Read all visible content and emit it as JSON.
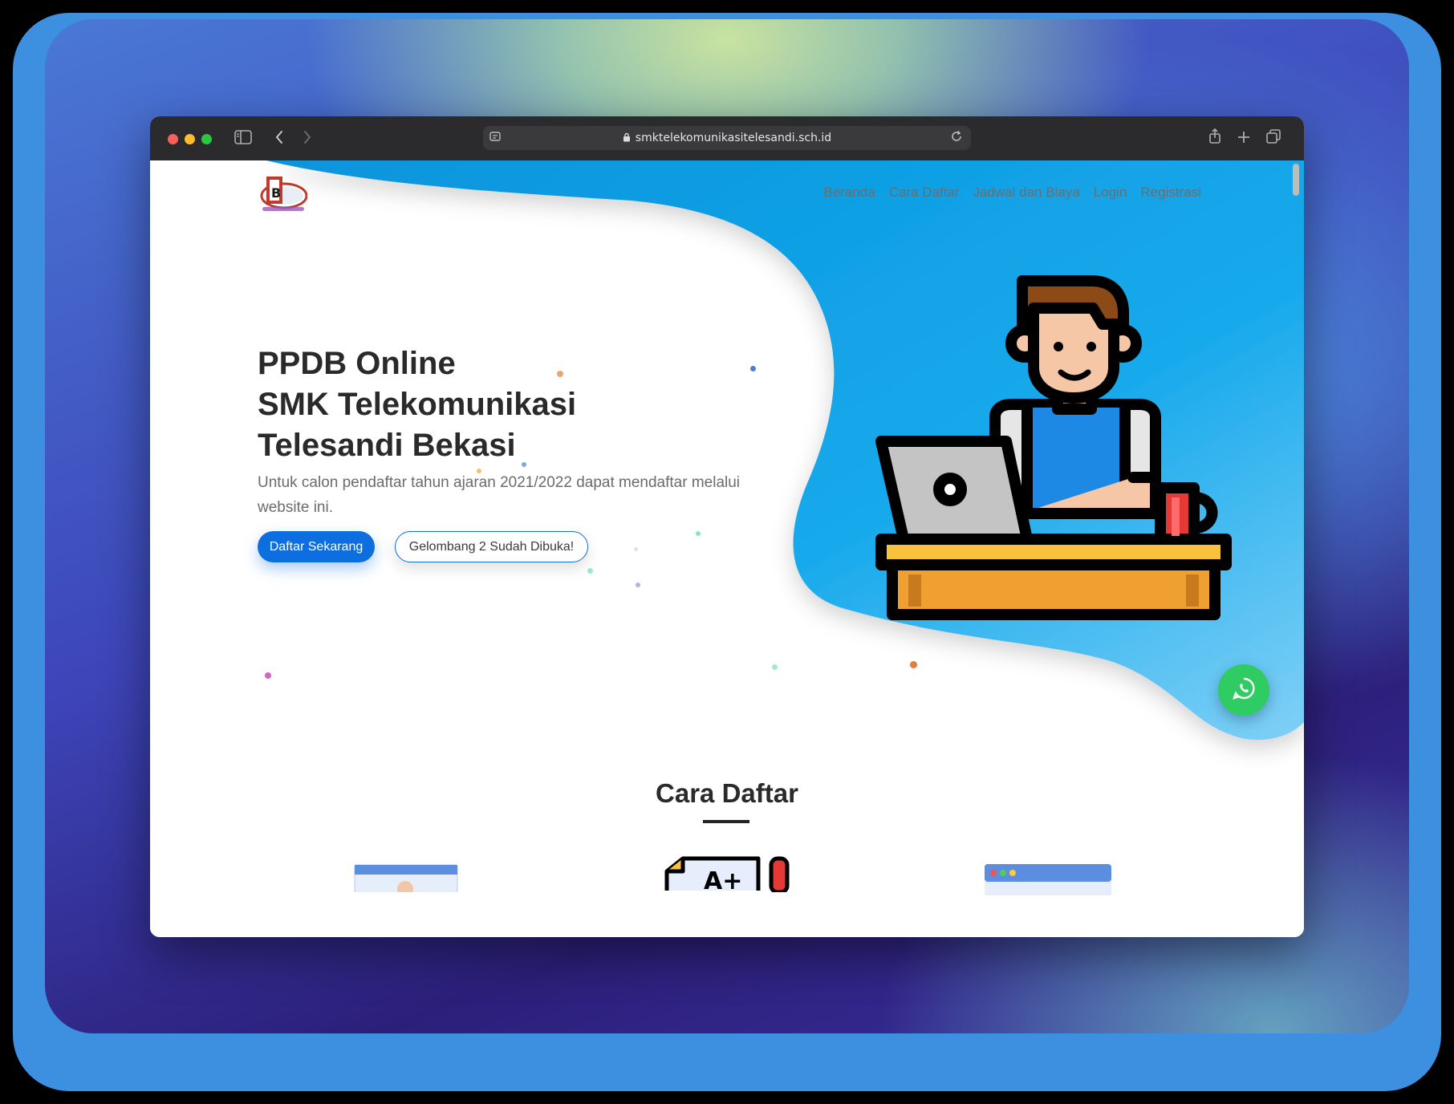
{
  "browser": {
    "url": "smktelekomunikasitelesandi.sch.id"
  },
  "nav": {
    "items": [
      "Beranda",
      "Cara Daftar",
      "Jadwal dan Biaya",
      "Login",
      "Registrasi"
    ]
  },
  "hero": {
    "title_line1": "PPDB Online",
    "title_line2": "SMK Telekomunikasi",
    "title_line3": "Telesandi Bekasi",
    "subtitle": "Untuk calon pendaftar tahun ajaran 2021/2022 dapat mendaftar melalui website ini.",
    "primary_button": "Daftar Sekarang",
    "secondary_button": "Gelombang 2 Sudah Dibuka!"
  },
  "section": {
    "title": "Cara Daftar"
  },
  "colors": {
    "primary": "#0d6ee0",
    "whatsapp": "#2ecc63",
    "hero_blob": "#0e9ee0"
  },
  "icons": [
    "sidebar-icon",
    "back-icon",
    "forward-icon",
    "lock-icon",
    "reload-icon",
    "share-icon",
    "new-tab-icon",
    "tabs-icon",
    "whatsapp-icon"
  ]
}
